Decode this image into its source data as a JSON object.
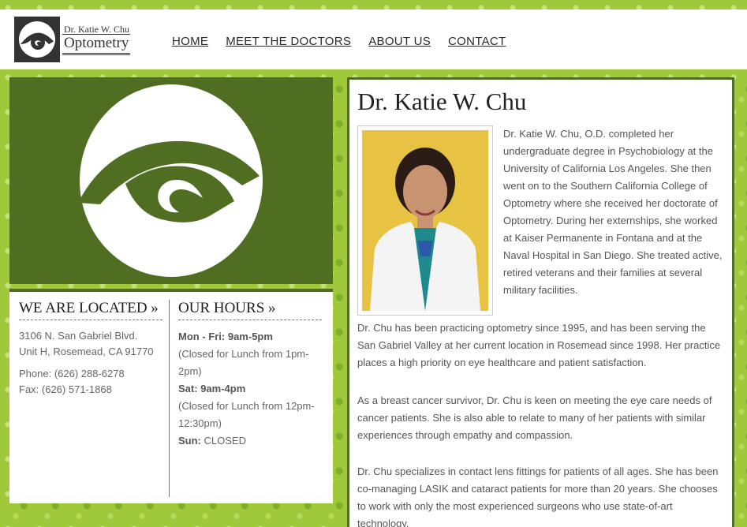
{
  "header": {
    "logo_line1": "Dr. Katie W. Chu",
    "logo_line2": "Optometry",
    "nav": [
      {
        "label": "HOME"
      },
      {
        "label": "MEET THE DOCTORS"
      },
      {
        "label": "ABOUT US"
      },
      {
        "label": "CONTACT"
      }
    ]
  },
  "location": {
    "heading": "WE ARE LOCATED »",
    "address1": "3106 N. San Gabriel Blvd.",
    "address2": "Unit H, Rosemead, CA 91770",
    "phone": "Phone: (626) 288-6278",
    "fax": "Fax: (626) 571-1868"
  },
  "hours": {
    "heading": "OUR HOURS »",
    "weekday_label": "Mon - Fri:",
    "weekday_time": "9am-5pm",
    "weekday_note": "(Closed for Lunch from 1pm-2pm)",
    "sat_label": "Sat:",
    "sat_time": "9am-4pm",
    "sat_note": "(Closed for Lunch from 12pm-12:30pm)",
    "sun_label": "Sun:",
    "sun_time": "CLOSED"
  },
  "doctor": {
    "name": "Dr. Katie W. Chu",
    "bio1": "Dr. Katie W. Chu, O.D. completed her undergraduate degree in Psychobiology at the University of California Los Angeles. She then went on to the Southern California College of Optometry where she received her doctorate of Optometry. During her externships, she worked at Kaiser Permanente in Fontana and at the Naval Hospital in San Diego. She treated active, retired veterans and their families at several military facilities.",
    "bio2": "Dr. Chu has been practicing optometry since 1995, and has been serving the San Gabriel Valley at her current location in Rosemead since 1998. Her practice places a high priority on eye healthcare and patient satisfaction.",
    "bio3": "As a breast cancer survivor, Dr. Chu is keen on meeting the eye care needs of cancer patients. She is also able to relate to many of her patients with similar experiences through empathy and compassion.",
    "bio4": "Dr. Chu specializes in contact lens fittings for patients of all ages. She has been co-managing LASIK and cataract patients for more than 20 years. She chooses to work with only the most experienced surgeons who use state-of-art technology."
  },
  "colors": {
    "brand_green": "#4f6e22",
    "background_green": "#9fc83a"
  }
}
